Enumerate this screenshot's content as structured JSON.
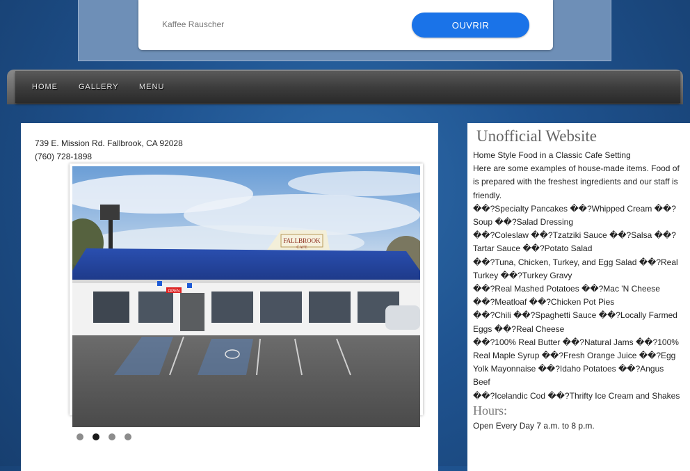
{
  "ad": {
    "brand": "Kaffee Rauscher",
    "button_label": "OUVRIR"
  },
  "nav": {
    "items": [
      {
        "label": "HOME"
      },
      {
        "label": "GALLERY"
      },
      {
        "label": "MENU"
      }
    ]
  },
  "contact": {
    "address": "739 E. Mission Rd. Fallbrook, CA 92028",
    "phone": "(760) 728-1898"
  },
  "slideshow": {
    "sign_name": "FALLBROOK",
    "sign_sub": "CAFE",
    "open_sign": "OPEN",
    "dots": [
      {
        "active": false
      },
      {
        "active": true
      },
      {
        "active": false
      },
      {
        "active": false
      }
    ]
  },
  "sidebar": {
    "title": "Unofficial Website",
    "intro": "Home Style Food in a Classic Cafe Setting",
    "desc": "Here are some examples of house-made items. Food of is prepared with the freshest ingredients and our staff is friendly.",
    "items": [
      "��?Specialty Pancakes ��?Whipped Cream ��?Soup ��?Salad Dressing",
      "��?Coleslaw ��?Tzatziki Sauce ��?Salsa ��?Tartar Sauce ��?Potato Salad",
      "��?Tuna, Chicken, Turkey, and Egg Salad ��?Real Turkey ��?Turkey Gravy",
      "��?Real Mashed Potatoes ��?Mac 'N Cheese ��?Meatloaf ��?Chicken Pot Pies",
      "��?Chili ��?Spaghetti Sauce ��?Locally Farmed Eggs ��?Real Cheese",
      "��?100% Real Butter ��?Natural Jams ��?100% Real Maple Syrup ��?Fresh Orange Juice ��?Egg Yolk Mayonnaise ��?Idaho Potatoes ��?Angus Beef",
      "��?Icelandic Cod ��?Thrifty Ice Cream and Shakes"
    ],
    "hours_title": "Hours:",
    "hours_text": "Open Every Day 7 a.m. to 8 p.m."
  }
}
